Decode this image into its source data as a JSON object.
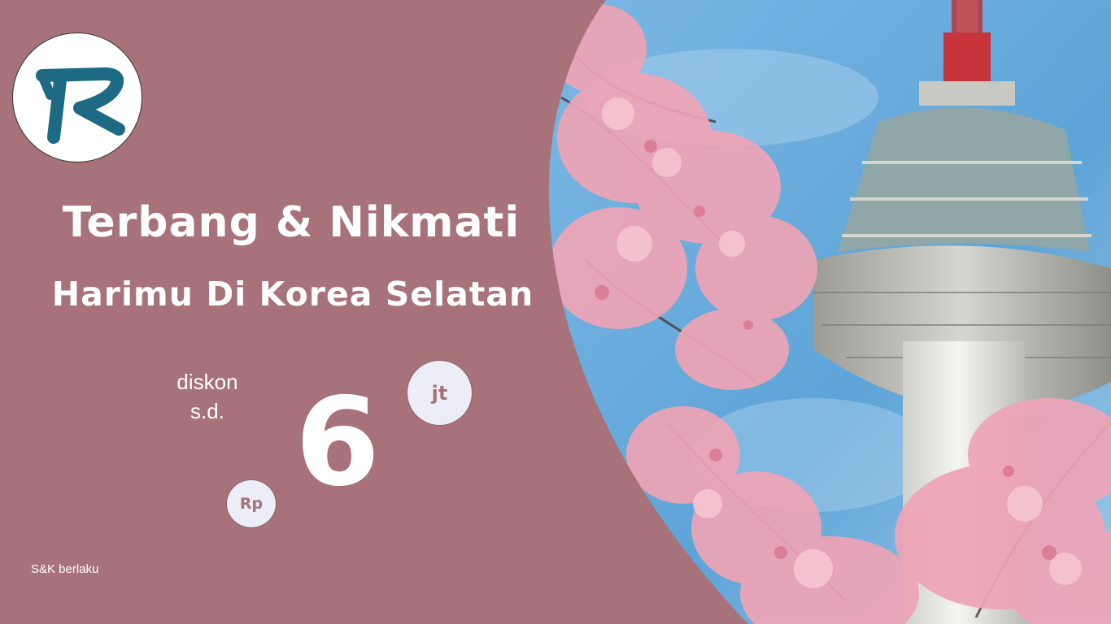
{
  "logo": {
    "icon": "r-logo-icon",
    "color": "#1e6a85"
  },
  "headline": {
    "line1": "Terbang & Nikmati",
    "line2": "Harimu Di Korea Selatan"
  },
  "promo": {
    "label_line1": "diskon",
    "label_line2": "s.d.",
    "currency": "Rp",
    "amount": "6",
    "unit": "jt"
  },
  "footer": {
    "terms": "S&K berlaku"
  },
  "colors": {
    "background": "#a7727a",
    "bubble": "#ecedf7",
    "sky": "#6fb0df",
    "blossom": "#eea3b4",
    "text": "#ffffff"
  }
}
